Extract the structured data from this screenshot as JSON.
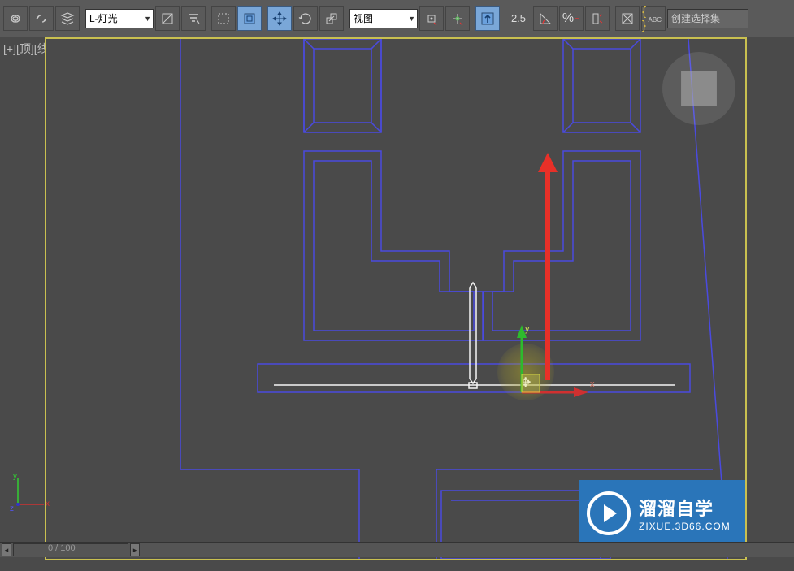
{
  "toolbar": {
    "layer_select": "L-灯光",
    "coord_select": "视图",
    "grid_value": "2.5",
    "selection_set_placeholder": "创建选择集"
  },
  "viewport": {
    "label_plus": "[+]",
    "label_view": "[顶]",
    "label_shade": "[线框]"
  },
  "gizmo": {
    "axis_y": "y",
    "axis_x": "x"
  },
  "world_axis": {
    "x": "x",
    "y": "y",
    "z": "z"
  },
  "watermark": {
    "title": "溜溜自学",
    "subtitle": "ZIXUE.3D66.COM"
  },
  "statusbar": {
    "frame": "0 / 100"
  }
}
